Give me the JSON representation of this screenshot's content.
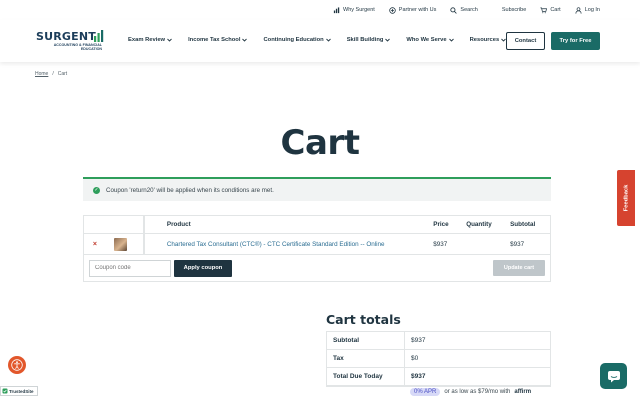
{
  "topbar": {
    "links": [
      "Why Surgent",
      "Partner with Us",
      "Search",
      "Subscribe",
      "Cart",
      "Log In"
    ]
  },
  "logo": {
    "brand": "SURGENT",
    "tagline": "ACCOUNTING & FINANCIAL EDUCATION"
  },
  "nav": {
    "items": [
      "Exam Review",
      "Income Tax School",
      "Continuing Education",
      "Skill Building",
      "Who We Serve",
      "Resources"
    ],
    "contact_label": "Contact",
    "try_label": "Try for Free"
  },
  "breadcrumb": {
    "home": "Home",
    "separator": "/",
    "current": "Cart"
  },
  "page_title": "Cart",
  "notice": "Coupon 'return20' will be applied when its conditions are met.",
  "cart": {
    "headers": {
      "product": "Product",
      "price": "Price",
      "quantity": "Quantity",
      "subtotal": "Subtotal"
    },
    "items": [
      {
        "remove": "×",
        "name": "Chartered Tax Consultant (CTC®) - CTC Certificate Standard Edition -- Online",
        "price": "$937",
        "quantity": "",
        "subtotal": "$937"
      }
    ],
    "coupon_placeholder": "Coupon code",
    "apply_label": "Apply coupon",
    "update_label": "Update cart"
  },
  "totals": {
    "title": "Cart totals",
    "rows": [
      {
        "label": "Subtotal",
        "value": "$937"
      },
      {
        "label": "Tax",
        "value": "$0"
      },
      {
        "label": "Total Due Today",
        "value": "$937"
      }
    ],
    "affirm_apr": "0% APR",
    "affirm_text": "or as low as $79/mo with",
    "affirm_brand": "affirm"
  },
  "feedback_label": "Feedback",
  "trusted_label": "TrustedSite",
  "colors": {
    "primary": "#1f3440",
    "accent": "#1a6b66",
    "success": "#2e9e5b",
    "danger": "#c0392b",
    "feedback": "#d6432f"
  }
}
